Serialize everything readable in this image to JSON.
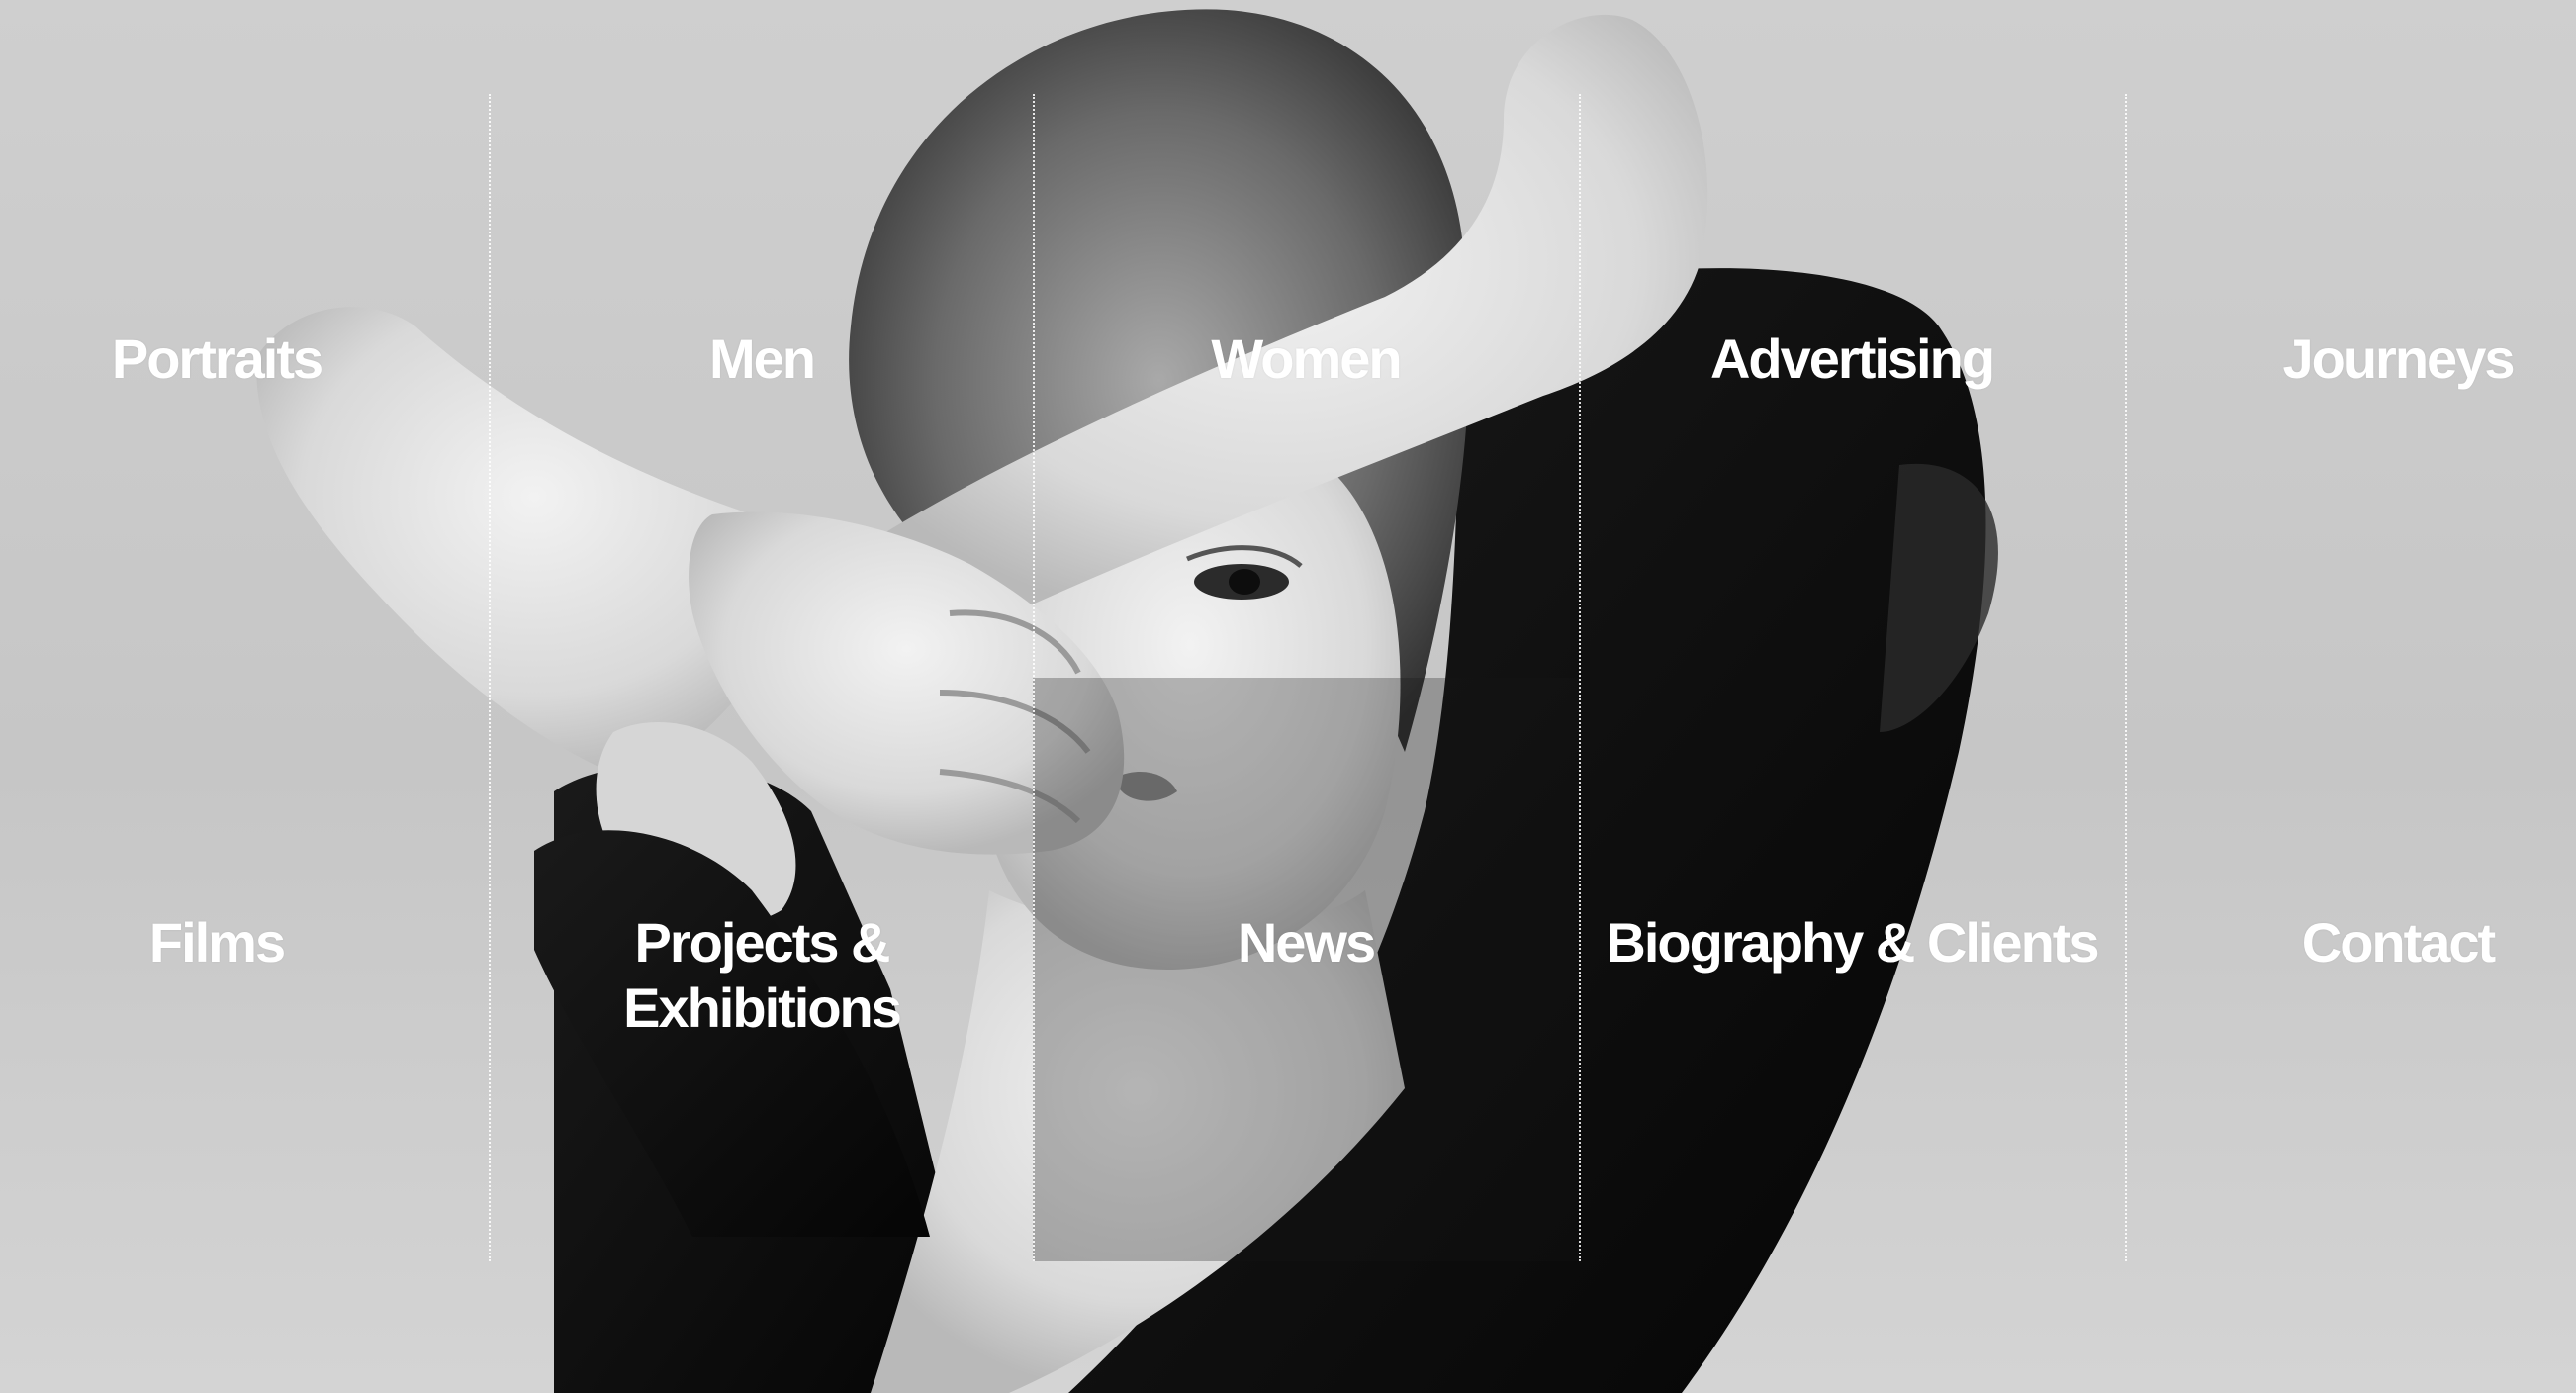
{
  "nav": {
    "row1": [
      {
        "id": "portraits",
        "label": "Portraits"
      },
      {
        "id": "men",
        "label": "Men"
      },
      {
        "id": "women",
        "label": "Women"
      },
      {
        "id": "advertising",
        "label": "Advertising"
      },
      {
        "id": "journeys",
        "label": "Journeys"
      }
    ],
    "row2": [
      {
        "id": "films",
        "label": "Films"
      },
      {
        "id": "projects-exhibitions",
        "label": "Projects & Exhibitions"
      },
      {
        "id": "news",
        "label": "News"
      },
      {
        "id": "biography-clients",
        "label": "Biography & Clients"
      },
      {
        "id": "contact",
        "label": "Contact"
      }
    ]
  },
  "colors": {
    "text": "#ffffff",
    "divider": "#ffffff",
    "background": "#c9c9c9",
    "photo_dark": "#0e0e0e"
  }
}
